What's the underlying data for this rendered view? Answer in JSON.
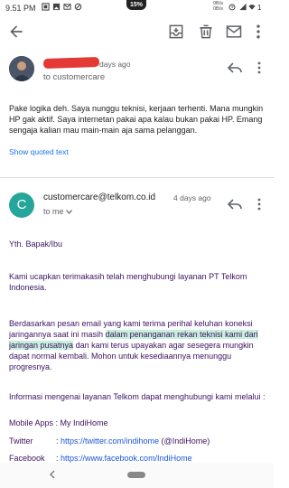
{
  "status": {
    "time": "9.51 PM",
    "battery_pct": "15%",
    "net_up": "0B/s",
    "net_down": "0B/s",
    "right_label": "1"
  },
  "toolbar": {
    "back": "arrow-back-icon",
    "archive": "archive-icon",
    "delete": "delete-icon",
    "mail": "mail-icon",
    "more": "more-vert-icon"
  },
  "message1": {
    "time": "days ago",
    "to": "to customercare",
    "body": "Pake logika deh. Saya nunggu teknisi, kerjaan terhenti. Mana mungkin HP gak aktif. Saya internetan pakai apa kalau bukan pakai HP. Emang sengaja kalian mau main-main aja sama pelanggan.",
    "show_quoted": "Show quoted text"
  },
  "message2": {
    "avatar_letter": "C",
    "sender": "customercare@telkom.co.id",
    "time": "4 days ago",
    "to": "to me",
    "greeting": "Yth. Bapak/Ibu",
    "para1": "Kami ucapkan terimakasih telah menghubungi layanan PT Telkom Indonesia.",
    "para2_start": "Berdasarkan pesan email yang kami terima perihal keluhan koneksi jaringannya saat ini masih ",
    "para2_highlight": "dalam penanganan rekan teknisi kami dari jaringan pusatnya",
    "para2_end": " dan kami terus upayakan agar sesegera mungkin dapat normal kembali. Mohon untuk kesediaannya menunggu progresnya.",
    "info": "Informasi mengenai layanan Telkom dapat menghubungi kami melalui :",
    "mobile_label": "Mobile Apps",
    "mobile_value": ": My IndiHome",
    "twitter_label": "Twitter",
    "twitter_sep": ": ",
    "twitter_link": "https://twitter.com/indihome",
    "twitter_handle": " (@IndiHome)",
    "facebook_label": "Facebook",
    "facebook_sep": ": ",
    "facebook_link": "https://www.facebook.com/IndiHome"
  },
  "colors": {
    "accent": "#1a73e8",
    "avatar_c": "#26a69a",
    "highlight": "#c8efdc",
    "body_text": "#3c1361",
    "redaction": "#e53935"
  }
}
